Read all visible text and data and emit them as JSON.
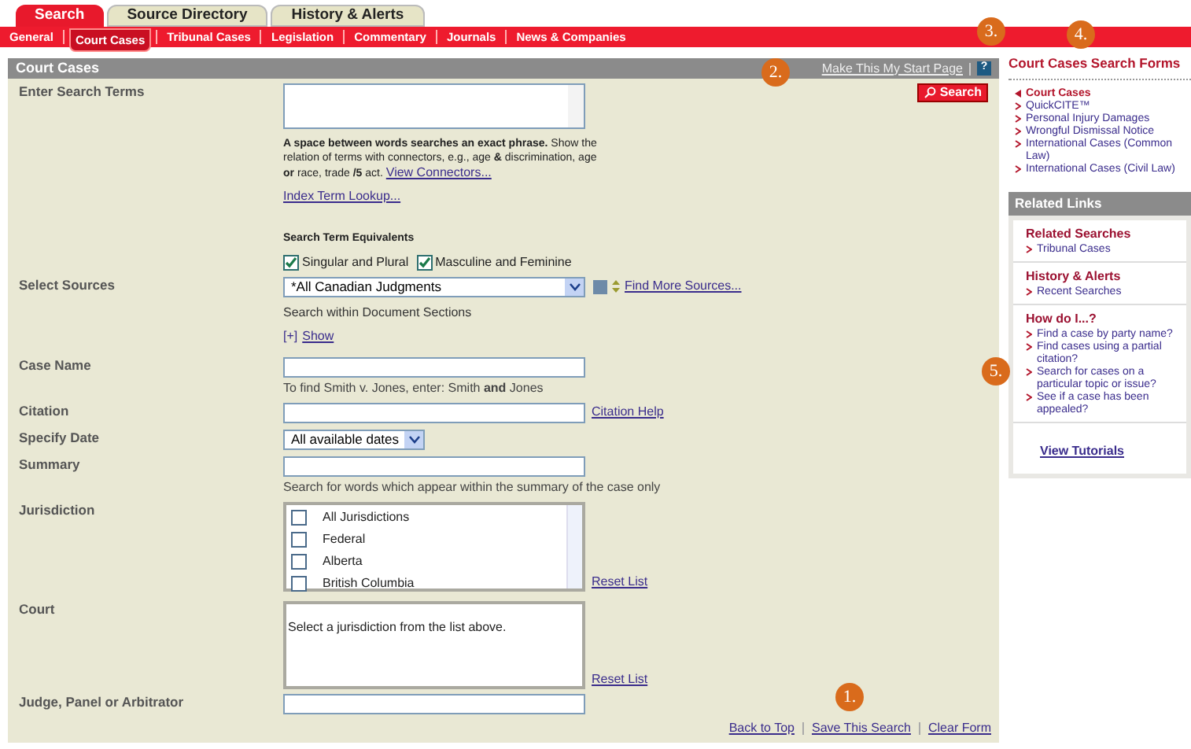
{
  "top_tabs": [
    {
      "label": "Search",
      "selected": true
    },
    {
      "label": "Source Directory",
      "selected": false
    },
    {
      "label": "History & Alerts",
      "selected": false
    }
  ],
  "sub_tabs": [
    {
      "label": "General",
      "selected": false
    },
    {
      "label": "Court Cases",
      "selected": true
    },
    {
      "label": "Tribunal Cases",
      "selected": false
    },
    {
      "label": "Legislation",
      "selected": false
    },
    {
      "label": "Commentary",
      "selected": false
    },
    {
      "label": "Journals",
      "selected": false
    },
    {
      "label": "News & Companies",
      "selected": false
    }
  ],
  "panel": {
    "title": "Court Cases",
    "start_page_link": "Make This My Start Page",
    "help_icon": "?",
    "search_button": "Search"
  },
  "search_terms": {
    "label": "Enter Search Terms",
    "help": "**A space between words searches an exact phrase.** Show the relation of terms with connectors, e.g., age **&** discrimination, age **or** race, trade **/5** act.",
    "connectors_link": "View Connectors...",
    "index_link": "Index Term Lookup...",
    "equivalents_title": "Search Term Equivalents",
    "equivalents": [
      {
        "label": "Singular and Plural",
        "checked": true
      },
      {
        "label": "Masculine and Feminine",
        "checked": true
      }
    ]
  },
  "sources": {
    "label": "Select Sources",
    "value": "*All Canadian Judgments",
    "find_link": "Find More Sources...",
    "sections_text": "Search within Document Sections",
    "expand": "[+]",
    "show_link": "Show"
  },
  "case_name": {
    "label": "Case Name",
    "hint": "To find Smith v. Jones, enter: Smith **and** Jones"
  },
  "citation": {
    "label": "Citation",
    "help_link": "Citation Help"
  },
  "date": {
    "label": "Specify Date",
    "value": "All available dates"
  },
  "summary": {
    "label": "Summary",
    "hint": "Search for words which appear within the summary of the case only"
  },
  "jurisdiction": {
    "label": "Jurisdiction",
    "reset_link": "Reset List",
    "options": [
      {
        "label": "All Jurisdictions",
        "checked": false
      },
      {
        "label": "Federal",
        "checked": false
      },
      {
        "label": "Alberta",
        "checked": false
      },
      {
        "label": "British Columbia",
        "checked": false
      }
    ]
  },
  "court": {
    "label": "Court",
    "value": "Select a jurisdiction from the list above.",
    "reset_link": "Reset List"
  },
  "judge": {
    "label": "Judge, Panel or Arbitrator"
  },
  "footer_links": [
    "Back to Top",
    "Save This Search",
    "Clear Form"
  ],
  "sidebar": {
    "forms_title": "Court Cases Search Forms",
    "forms": [
      {
        "label": "Court Cases",
        "selected": true
      },
      {
        "label": "QuickCITE™",
        "selected": false
      },
      {
        "label": "Personal Injury Damages",
        "selected": false
      },
      {
        "label": "Wrongful Dismissal Notice",
        "selected": false
      },
      {
        "label": "International Cases (Common Law)",
        "selected": false
      },
      {
        "label": "International Cases (Civil Law)",
        "selected": false
      }
    ],
    "related_title": "Related Links",
    "sections": [
      {
        "title": "Related Searches",
        "links": [
          "Tribunal Cases"
        ]
      },
      {
        "title": "History & Alerts",
        "links": [
          "Recent Searches"
        ]
      },
      {
        "title": "How do I...?",
        "links": [
          "Find a case by party name?",
          "Find cases using a partial citation?",
          "Search for cases on a particular topic or issue?",
          "See if a case has been appealed?"
        ]
      }
    ],
    "tutorials_link": "View Tutorials"
  },
  "callouts": [
    "1.",
    "2.",
    "3.",
    "4.",
    "5."
  ]
}
